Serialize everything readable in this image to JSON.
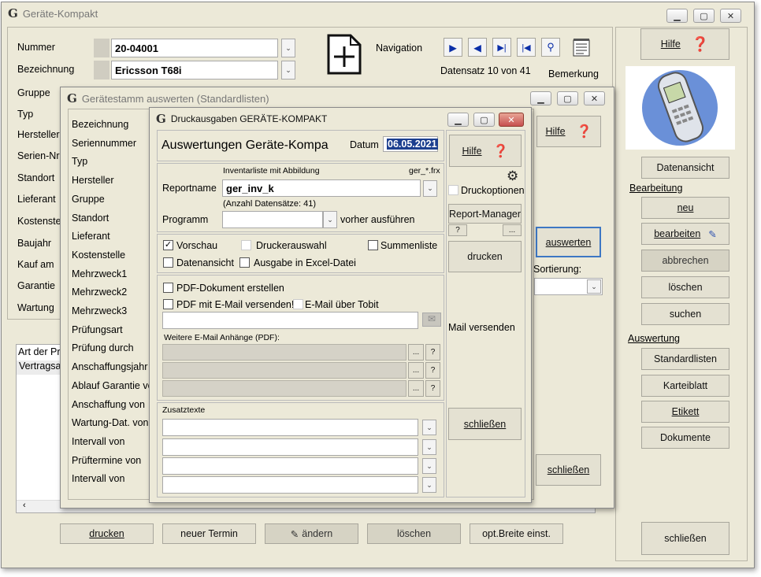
{
  "main": {
    "title": "Geräte-Kompakt",
    "logo": "G",
    "labels": {
      "nummer": "Nummer",
      "bezeichnung": "Bezeichnung",
      "gruppe": "Gruppe",
      "typ": "Typ",
      "hersteller": "Hersteller",
      "serien": "Serien-Nr",
      "standort": "Standort",
      "lieferant": "Lieferant",
      "kosten": "Kostenste",
      "baujahr": "Baujahr",
      "kauf": "Kauf am",
      "garantie": "Garantie",
      "wartung": "Wartung"
    },
    "nummer_value": "20-04001",
    "bezeichnung_value": "Ericsson T68i",
    "navigation_label": "Navigation",
    "datensatz": "Datensatz 10 von 41",
    "bemerkung": "Bemerkung",
    "list_header": "Art der Pr",
    "list_row": "Vertragsa",
    "bottom_buttons": [
      "drucken",
      "neuer Termin",
      "ändern",
      "löschen",
      "opt.Breite einst."
    ]
  },
  "side": {
    "hilfe": "Hilfe",
    "datenansicht": "Datenansicht",
    "bearbeitung": "Bearbeitung",
    "neu": "neu",
    "bearbeiten": "bearbeiten",
    "abbrechen": "abbrechen",
    "loeschen": "löschen",
    "suchen": "suchen",
    "auswertung": "Auswertung",
    "standardlisten": "Standardlisten",
    "karteiblatt": "Karteiblatt",
    "etikett": "Etikett",
    "dokumente": "Dokumente",
    "schliessen": "schließen"
  },
  "mid": {
    "title": "Gerätestamm auswerten (Standardlisten)",
    "logo": "G",
    "fields": [
      "Bezeichnung",
      "Seriennummer",
      "Typ",
      "Hersteller",
      "Gruppe",
      "Standort",
      "Lieferant",
      "Kostenstelle",
      "Mehrzweck1",
      "Mehrzweck2",
      "Mehrzweck3",
      "Prüfungsart",
      "Prüfung durch",
      "Anschaffungsjahr",
      "Ablauf Garantie vo",
      "Anschaffung von",
      "Wartung-Dat. von",
      "Intervall von",
      "Prüftermine von",
      "Intervall von"
    ],
    "hilfe": "Hilfe",
    "auswerten": "auswerten",
    "sortierung": "Sortierung:",
    "schliessen": "schließen"
  },
  "dlg": {
    "title": "Druckausgaben  GERÄTE-KOMPAKT",
    "logo": "G",
    "heading": "Auswertungen Geräte-Kompa",
    "datum_label": "Datum",
    "datum_value": "06.05.2021",
    "inventar_label": "Inventarliste mit Abbildung",
    "file_pattern": "ger_*.frx",
    "reportname_label": "Reportname",
    "reportname_value": "ger_inv_k",
    "anzahl": "(Anzahl Datensätze: 41)",
    "programm_label": "Programm",
    "vorher": "vorher ausführen",
    "vorschau": "Vorschau",
    "druckerauswahl": "Druckerauswahl",
    "summenliste": "Summenliste",
    "datenansicht": "Datenansicht",
    "excel": "Ausgabe in Excel-Datei",
    "pdf_erstellen": "PDF-Dokument erstellen",
    "pdf_email": "PDF mit E-Mail versenden!",
    "tobit": "E-Mail über Tobit",
    "weitere": "Weitere E-Mail Anhänge (PDF):",
    "zusatztexte": "Zusatztexte",
    "hilfe": "Hilfe",
    "druckoptionen": "Druckoptionen",
    "report_manager": "Report-Manager",
    "q": "?",
    "dots": "...",
    "drucken": "drucken",
    "mail_versenden": "Mail versenden",
    "schliessen": "schließen"
  }
}
